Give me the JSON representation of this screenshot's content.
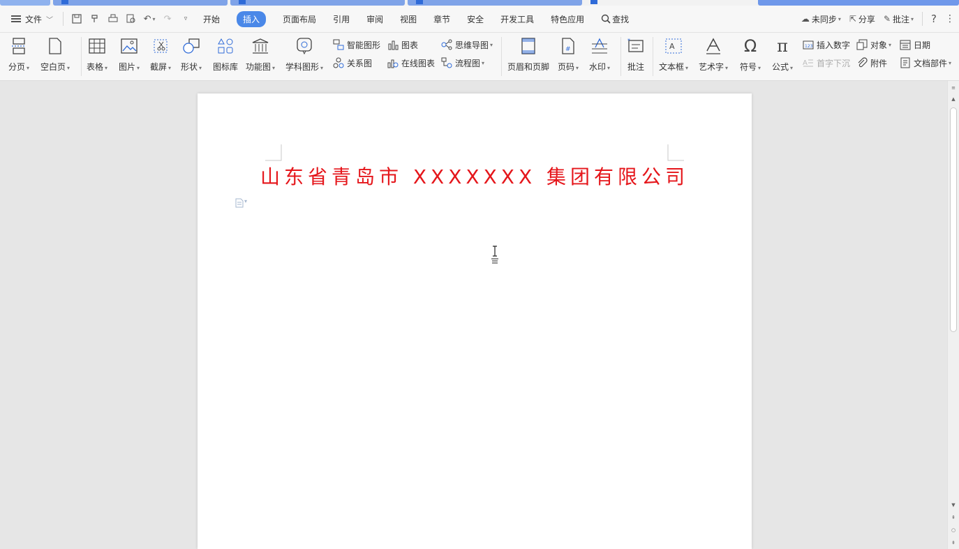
{
  "menubar": {
    "file_label": "文件",
    "tabs": [
      {
        "label": "开始",
        "active": false
      },
      {
        "label": "插入",
        "active": true
      },
      {
        "label": "页面布局",
        "active": false
      },
      {
        "label": "引用",
        "active": false
      },
      {
        "label": "审阅",
        "active": false
      },
      {
        "label": "视图",
        "active": false
      },
      {
        "label": "章节",
        "active": false
      },
      {
        "label": "安全",
        "active": false
      },
      {
        "label": "开发工具",
        "active": false
      },
      {
        "label": "特色应用",
        "active": false
      }
    ],
    "search_label": "查找",
    "sync_label": "未同步",
    "share_label": "分享",
    "comment_label": "批注",
    "help_label": "?"
  },
  "ribbon": {
    "page_break": "分页",
    "blank_page": "空白页",
    "table": "表格",
    "picture": "图片",
    "screenshot": "截屏",
    "shape": "形状",
    "icon_lib": "图标库",
    "func_chart": "功能图",
    "science_shape": "学科图形",
    "smart_shape": "智能图形",
    "relation_chart": "关系图",
    "chart": "图表",
    "online_chart": "在线图表",
    "mindmap": "思维导图",
    "flowchart": "流程图",
    "header_footer": "页眉和页脚",
    "page_number": "页码",
    "watermark": "水印",
    "comment": "批注",
    "textbox": "文本框",
    "wordart": "艺术字",
    "symbol": "符号",
    "formula": "公式",
    "insert_number": "插入数字",
    "drop_cap": "首字下沉",
    "object": "对象",
    "attachment": "附件",
    "date": "日期",
    "doc_parts": "文档部件"
  },
  "document": {
    "title": "山东省青岛市 XXXXXXX 集团有限公司",
    "title_color": "#e5161b"
  },
  "colors": {
    "accent": "#4a88e8",
    "tab_strip": "#7fa3e8"
  }
}
